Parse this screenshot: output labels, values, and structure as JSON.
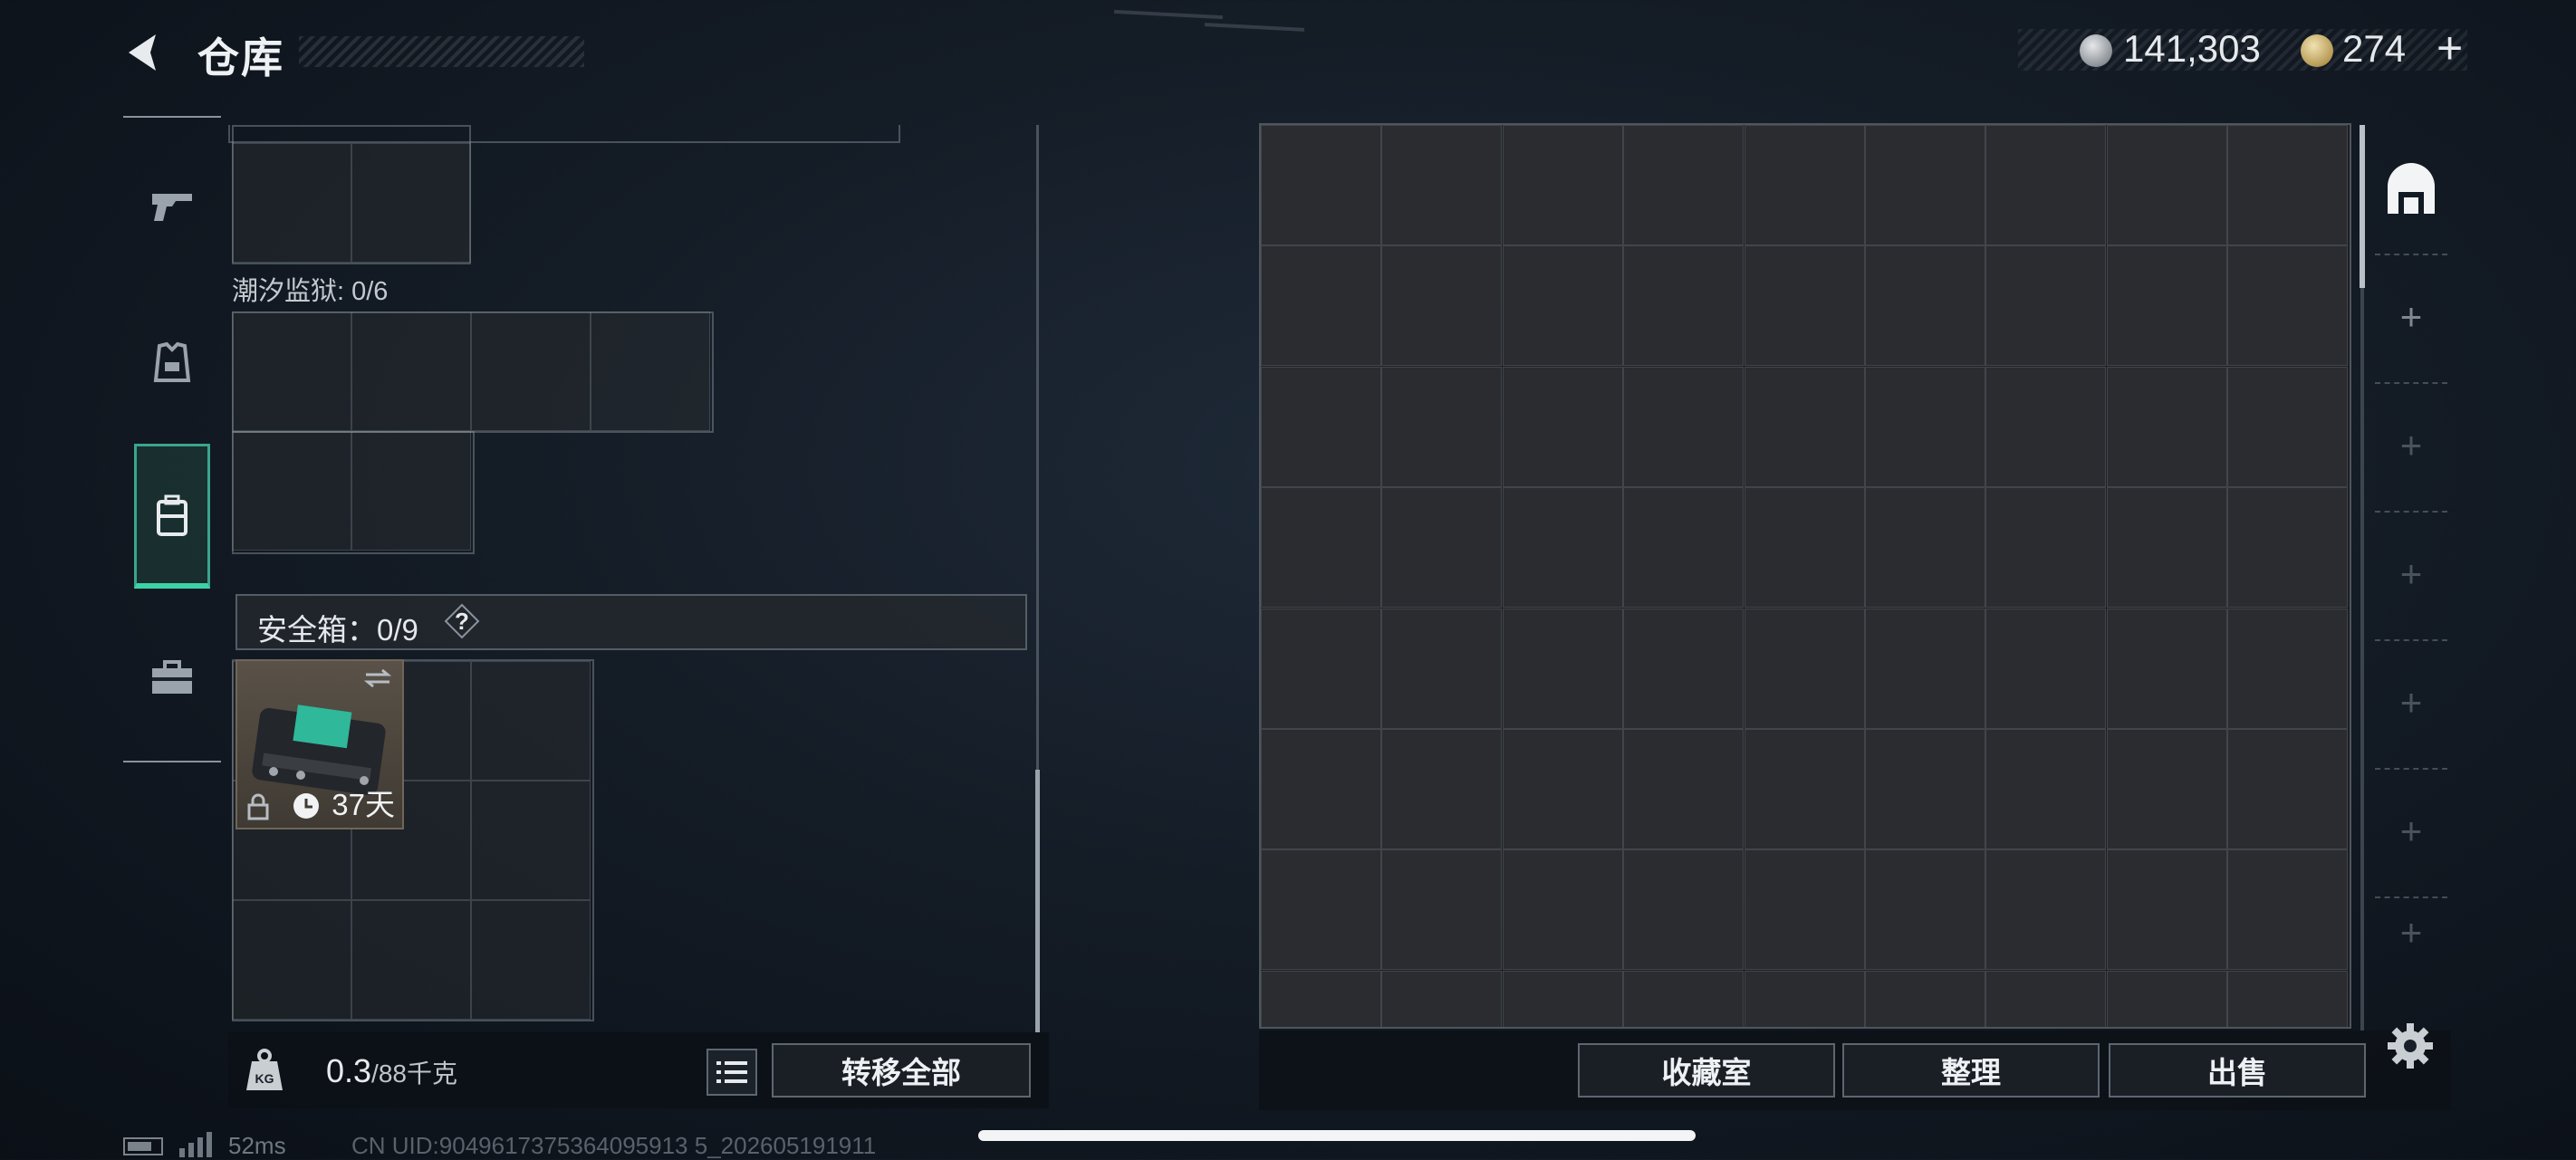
{
  "header": {
    "title": "仓库",
    "currency": {
      "silver_icon": "silver-coin-icon",
      "silver_value": "141,303",
      "gold_icon": "gold-coin-icon",
      "gold_value": "274",
      "add_label": "+"
    }
  },
  "nav": {
    "items": [
      {
        "name": "weapons",
        "icon": "pistol-icon",
        "active": false
      },
      {
        "name": "armor",
        "icon": "vest-icon",
        "active": false
      },
      {
        "name": "backpack",
        "icon": "backpack-icon",
        "active": true
      },
      {
        "name": "toolbox",
        "icon": "toolbox-icon",
        "active": false
      }
    ]
  },
  "backpack": {
    "section_tidal_prison": "潮汐监狱: 0/6",
    "safe_box_label": "安全箱：0/9",
    "help_label": "?",
    "safe_item": {
      "icon": "safe-box-icon",
      "days_left": "37天",
      "swap_icon": "swap-icon",
      "lock_icon": "lock-icon",
      "clock_icon": "clock-icon"
    }
  },
  "weight": {
    "current": "0.3",
    "max": "/88千克"
  },
  "buttons": {
    "transfer_all": "转移全部",
    "collection_room": "收藏室",
    "organize": "整理",
    "sell": "出售"
  },
  "warehouse": {
    "columns": 9,
    "tabs": [
      {
        "icon": "warehouse-icon",
        "active": true
      },
      {
        "label": "+"
      },
      {
        "label": "+"
      },
      {
        "label": "+"
      },
      {
        "label": "+"
      },
      {
        "label": "+"
      },
      {
        "label": "+"
      }
    ]
  },
  "status": {
    "ping": "52ms",
    "uid": "CN UID:9049617375364095913 5_202605191911"
  },
  "colors": {
    "accent": "#3cd3a6",
    "panel_bg": "#2c2e32",
    "text": "#e6e9ec"
  }
}
